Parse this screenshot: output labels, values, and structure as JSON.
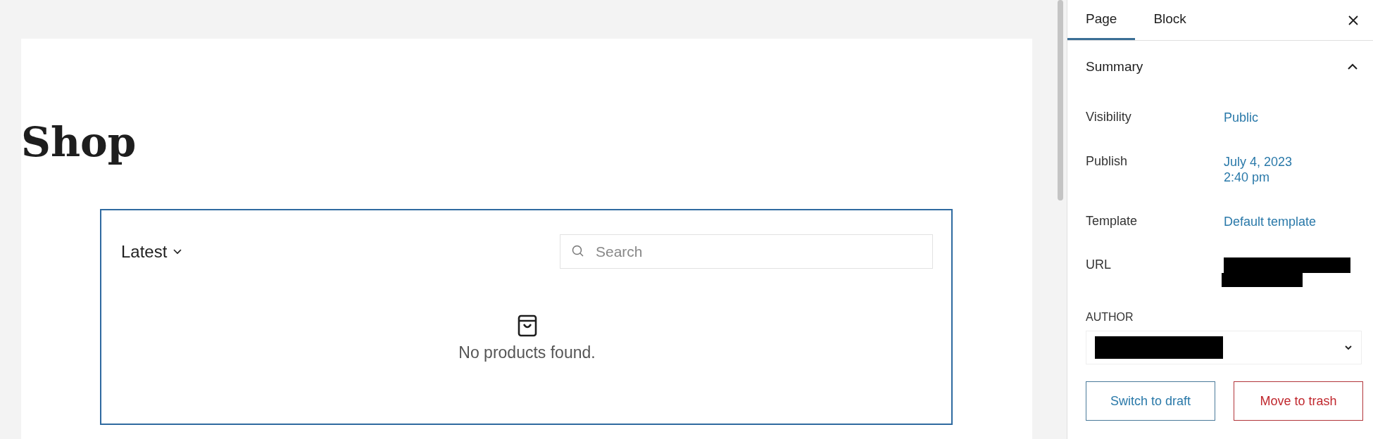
{
  "editor": {
    "page_title": "Shop",
    "block": {
      "sort": "Latest",
      "search": {
        "placeholder": "Search"
      },
      "empty_message": "No products found."
    }
  },
  "sidebar": {
    "tabs": [
      {
        "label": "Page",
        "selected": true
      },
      {
        "label": "Block",
        "selected": false
      }
    ],
    "panel": {
      "title": "Summary",
      "expanded": true,
      "rows": [
        {
          "label": "Visibility",
          "kind": "link",
          "value": [
            "Public"
          ]
        },
        {
          "label": "Publish",
          "kind": "link",
          "value": [
            "July 4, 2023",
            "2:40 pm"
          ]
        },
        {
          "label": "Template",
          "kind": "link",
          "value": [
            "Default template"
          ]
        },
        {
          "label": "URL",
          "kind": "redacted"
        }
      ],
      "author": {
        "label": "AUTHOR",
        "redacted": true
      },
      "buttons": [
        {
          "label": "Switch to draft",
          "kind": "primary"
        },
        {
          "label": "Move to trash",
          "kind": "danger"
        }
      ]
    }
  }
}
